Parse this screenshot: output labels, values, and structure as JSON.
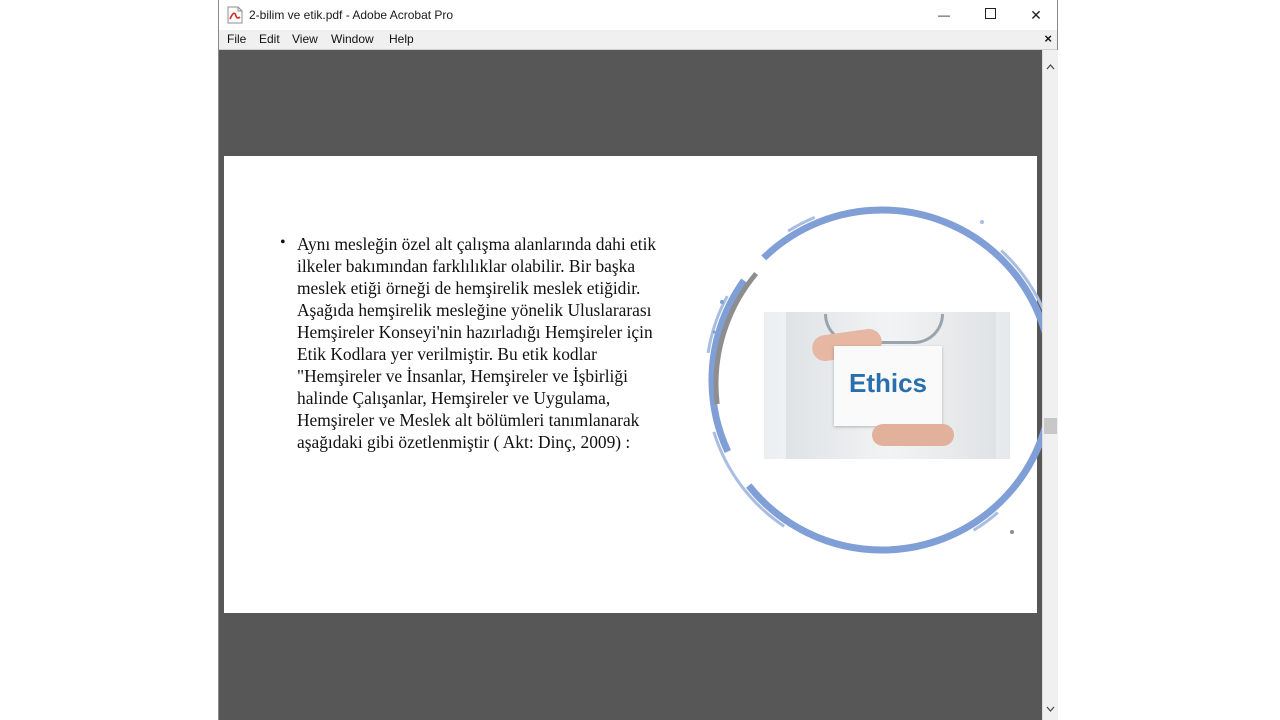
{
  "window": {
    "title": "2-bilim ve etik.pdf - Adobe Acrobat Pro",
    "minimize_glyph": "—",
    "close_glyph": "✕"
  },
  "menu": {
    "items": [
      "File",
      "Edit",
      "View",
      "Window",
      "Help"
    ],
    "doc_close_glyph": "×"
  },
  "slide": {
    "bullet": "•",
    "text": "Aynı mesleğin özel alt çalışma alanlarında dahi etik ilkeler bakımından farklılıklar olabilir. Bir başka meslek etiği örneği de hemşirelik meslek etiğidir. Aşağıda hemşirelik mesleğine yönelik Uluslararası Hemşireler Konseyi'nin hazırladığı Hemşireler için Etik Kodlara yer verilmiştir. Bu etik kodlar \"Hemşireler ve İnsanlar, Hemşireler ve İşbirliği halinde Çalışanlar, Hemşireler ve Uygulama, Hemşireler ve Meslek alt bölümleri tanımlanarak aşağıdaki gibi özetlenmiştir ( Akt: Dinç, 2009) :",
    "image_card_text": "Ethics"
  },
  "icons": {
    "app": "pdf-file-icon",
    "maximize": "maximize-icon",
    "scroll_up": "chevron-up-icon",
    "scroll_down": "chevron-down-icon"
  },
  "colors": {
    "viewport_bg": "#575757",
    "pdf_icon_red": "#d4281f",
    "circle_blue": "#7f9fd6",
    "ethics_text": "#2a6fad"
  }
}
